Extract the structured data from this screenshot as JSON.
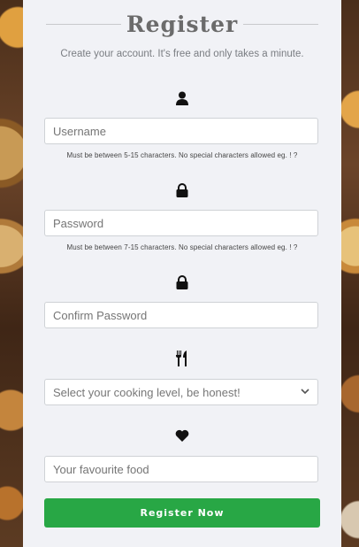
{
  "form": {
    "title": "Register",
    "subtitle": "Create your account. It's free and only takes a minute.",
    "username": {
      "placeholder": "Username",
      "help": "Must be between 5-15 characters. No special characters allowed eg. ! ?",
      "icon": "user-icon"
    },
    "password": {
      "placeholder": "Password",
      "help": "Must be between 7-15 characters. No special characters allowed eg. ! ?",
      "icon": "lock-icon"
    },
    "confirm_password": {
      "placeholder": "Confirm Password",
      "icon": "lock-icon"
    },
    "cooking_level": {
      "selected": "Select your cooking level, be honest!",
      "icon": "utensils-icon"
    },
    "favourite_food": {
      "placeholder": "Your favourite food",
      "icon": "heart-icon"
    },
    "submit_label": "Register Now"
  },
  "colors": {
    "panel": "#f1f2f6",
    "button": "#28a745"
  }
}
